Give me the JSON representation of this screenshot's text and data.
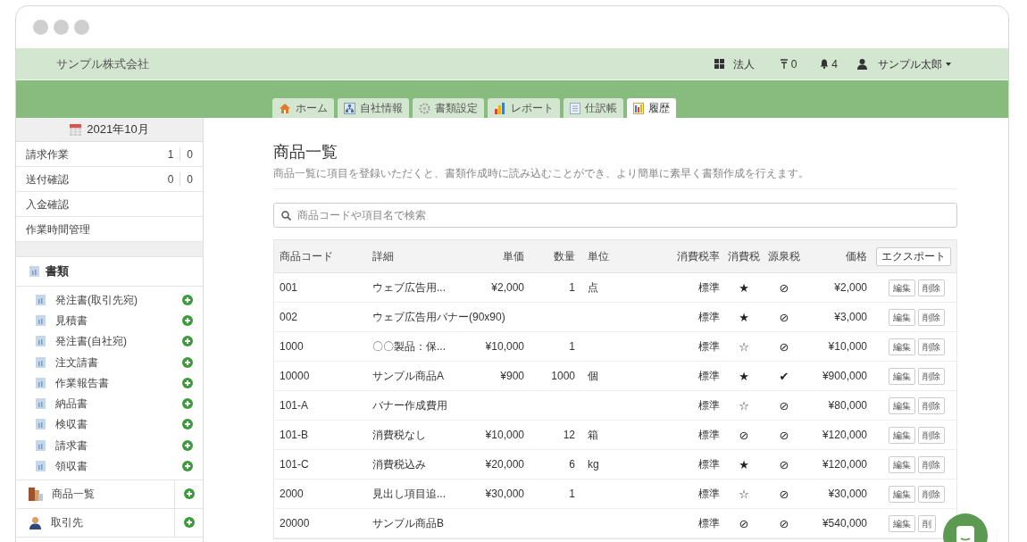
{
  "header": {
    "company": "サンプル株式会社",
    "entity": "法人",
    "tasks": "0",
    "notifications": "4",
    "user": "サンプル太郎"
  },
  "tabs": [
    {
      "label": "ホーム",
      "selected": false
    },
    {
      "label": "自社情報",
      "selected": false
    },
    {
      "label": "書類設定",
      "selected": false
    },
    {
      "label": "レポート",
      "selected": false
    },
    {
      "label": "仕訳帳",
      "selected": false
    },
    {
      "label": "履歴",
      "selected": true
    }
  ],
  "sidebar": {
    "month": "2021年10月",
    "tasks": [
      {
        "label": "請求作業",
        "count_1": "1",
        "count_2": "0"
      },
      {
        "label": "送付確認",
        "count_1": "0",
        "count_2": "0"
      },
      {
        "label": "入金確認"
      },
      {
        "label": "作業時間管理"
      }
    ],
    "documents_title": "書類",
    "documents": [
      "発注書(取引先宛)",
      "見積書",
      "発注書(自社宛)",
      "注文請書",
      "作業報告書",
      "納品書",
      "検収書",
      "請求書",
      "領収書"
    ],
    "links": [
      "商品一覧",
      "取引先"
    ]
  },
  "page": {
    "title": "商品一覧",
    "description": "商品一覧に項目を登録いただくと、書類作成時に読み込むことができ、より簡単に素早く書類作成を行えます。",
    "search": {
      "placeholder": "商品コードや項目名で検索"
    }
  },
  "table": {
    "columns": [
      "商品コード",
      "詳細",
      "単価",
      "数量",
      "単位",
      "消費税率",
      "消費税",
      "源泉税",
      "価格"
    ],
    "export": "エクスポート",
    "rows": [
      {
        "code": "001",
        "detail": "ウェブ広告用...",
        "unit_price": "¥2,000",
        "qty": "1",
        "unit": "点",
        "rate": "標準",
        "tax": "★",
        "withholding": "⊘",
        "price": "¥2,000",
        "edit": "編集",
        "delete": "削除"
      },
      {
        "code": "002",
        "detail": "ウェブ広告用バナー(90x90)",
        "rate": "標準",
        "tax": "★",
        "withholding": "⊘",
        "price": "¥3,000",
        "edit": "編集",
        "delete": "削除"
      },
      {
        "code": "1000",
        "detail": "〇〇製品：保...",
        "unit_price": "¥10,000",
        "qty": "1",
        "rate": "標準",
        "tax": "☆",
        "withholding": "⊘",
        "price": "¥10,000",
        "edit": "編集",
        "delete": "削除"
      },
      {
        "code": "10000",
        "detail": "サンプル商品A",
        "unit_price": "¥900",
        "qty": "1000",
        "unit": "個",
        "rate": "標準",
        "tax": "★",
        "withholding": "✔",
        "price": "¥900,000",
        "edit": "編集",
        "delete": "削除"
      },
      {
        "code": "101-A",
        "detail": "バナー作成費用",
        "rate": "標準",
        "tax": "☆",
        "withholding": "⊘",
        "price": "¥80,000",
        "edit": "編集",
        "delete": "削除"
      },
      {
        "code": "101-B",
        "detail": "消費税なし",
        "unit_price": "¥10,000",
        "qty": "12",
        "unit": "箱",
        "rate": "標準",
        "tax": "⊘",
        "withholding": "⊘",
        "price": "¥120,000",
        "edit": "編集",
        "delete": "削除"
      },
      {
        "code": "101-C",
        "detail": "消費税込み",
        "unit_price": "¥20,000",
        "qty": "6",
        "unit": "kg",
        "rate": "標準",
        "tax": "★",
        "withholding": "⊘",
        "price": "¥120,000",
        "edit": "編集",
        "delete": "削除"
      },
      {
        "code": "2000",
        "detail": "見出し項目追...",
        "unit_price": "¥30,000",
        "qty": "1",
        "rate": "標準",
        "tax": "☆",
        "withholding": "⊘",
        "price": "¥30,000",
        "edit": "編集",
        "delete": "削除"
      },
      {
        "code": "20000",
        "detail": "サンプル商品B",
        "rate": "標準",
        "tax": "⊘",
        "withholding": "⊘",
        "price": "¥540,000",
        "edit": "編集",
        "delete": "削"
      }
    ]
  }
}
